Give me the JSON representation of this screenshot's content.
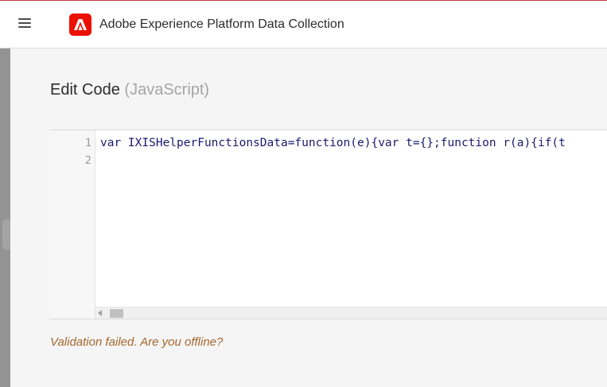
{
  "header": {
    "app_title": "Adobe Experience Platform Data Collection",
    "menu_icon": "hamburger-icon",
    "logo_icon": "adobe-logo-icon",
    "brand_color": "#eb1000"
  },
  "editor": {
    "title": "Edit Code",
    "language": "(JavaScript)",
    "lines": [
      {
        "number": "1",
        "code": "var IXISHelperFunctionsData=function(e){var t={};function r(a){if(t"
      },
      {
        "number": "2",
        "code": ""
      }
    ]
  },
  "status": {
    "validation_message": "Validation failed. Are you offline?",
    "message_color": "#a4662c"
  }
}
